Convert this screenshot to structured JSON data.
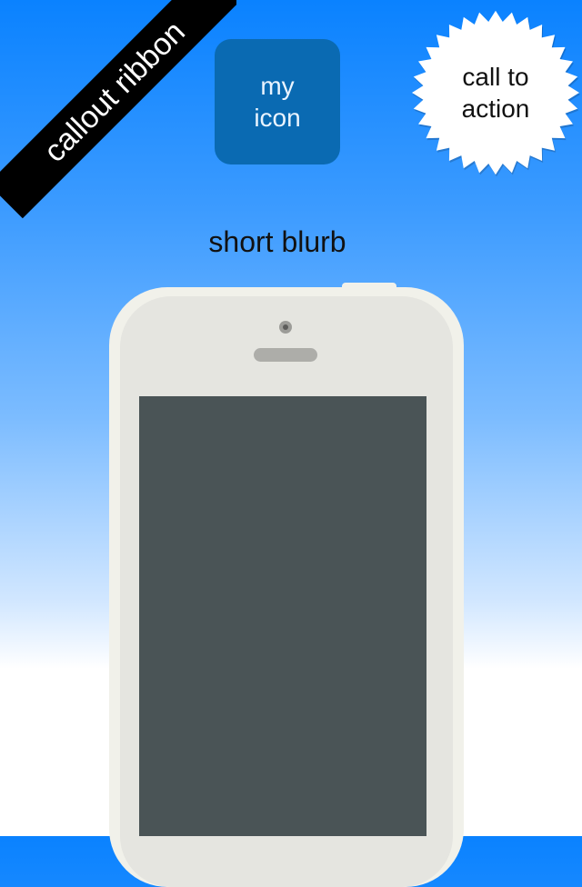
{
  "ribbon": {
    "label": "callout ribbon"
  },
  "app_icon": {
    "line1": "my",
    "line2": "icon"
  },
  "badge": {
    "line1": "call to",
    "line2": "action"
  },
  "blurb": {
    "text": "short blurb"
  },
  "colors": {
    "gradient_top": "#0a82ff",
    "gradient_bottom": "#ffffff",
    "ribbon_bg": "#000000",
    "icon_bg": "#0a6ab2",
    "phone_body": "#f1f1ea",
    "phone_screen": "#4a5456"
  }
}
